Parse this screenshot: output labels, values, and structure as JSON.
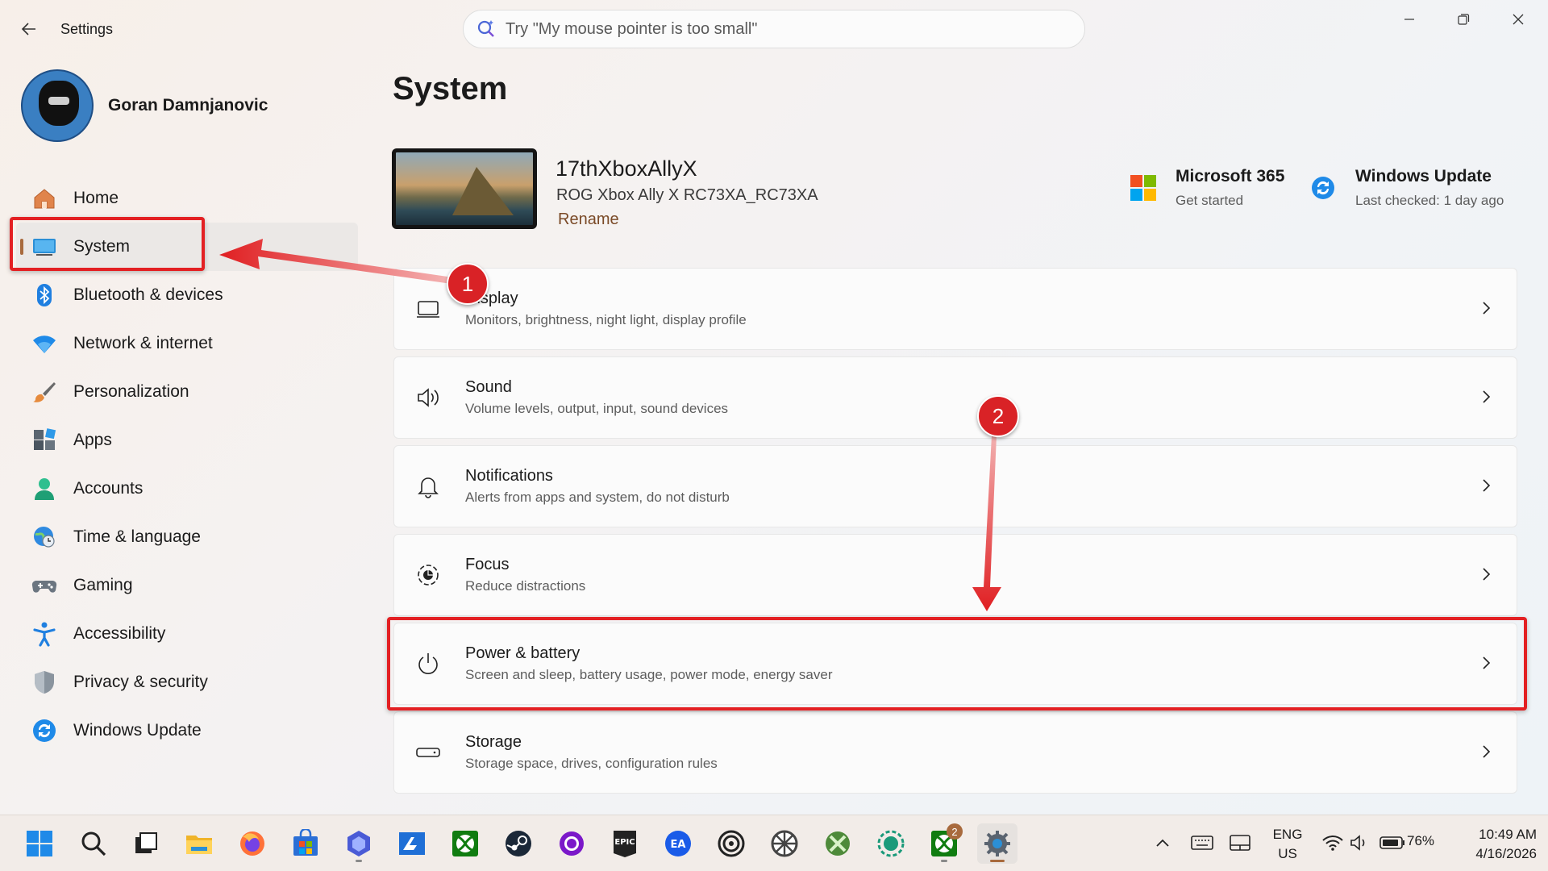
{
  "app": {
    "title": "Settings"
  },
  "search": {
    "placeholder": "Try \"My mouse pointer is too small\""
  },
  "profile": {
    "name": "Goran Damnjanovic"
  },
  "sidebar": {
    "items": [
      {
        "label": "Home",
        "icon": "home-icon",
        "active": false
      },
      {
        "label": "System",
        "icon": "system-icon",
        "active": true
      },
      {
        "label": "Bluetooth & devices",
        "icon": "bluetooth-icon",
        "active": false
      },
      {
        "label": "Network & internet",
        "icon": "wifi-icon",
        "active": false
      },
      {
        "label": "Personalization",
        "icon": "brush-icon",
        "active": false
      },
      {
        "label": "Apps",
        "icon": "apps-icon",
        "active": false
      },
      {
        "label": "Accounts",
        "icon": "accounts-icon",
        "active": false
      },
      {
        "label": "Time & language",
        "icon": "globe-clock-icon",
        "active": false
      },
      {
        "label": "Gaming",
        "icon": "gamepad-icon",
        "active": false
      },
      {
        "label": "Accessibility",
        "icon": "accessibility-icon",
        "active": false
      },
      {
        "label": "Privacy & security",
        "icon": "shield-icon",
        "active": false
      },
      {
        "label": "Windows Update",
        "icon": "update-icon",
        "active": false
      }
    ]
  },
  "main": {
    "page_title": "System",
    "device": {
      "name": "17thXboxAllyX",
      "model": "ROG Xbox Ally X RC73XA_RC73XA",
      "rename_label": "Rename"
    },
    "quick_links": {
      "ms365": {
        "title": "Microsoft 365",
        "subtitle": "Get started"
      },
      "windows_update": {
        "title": "Windows Update",
        "subtitle": "Last checked: 1 day ago"
      }
    },
    "cards": [
      {
        "title": "Display",
        "desc": "Monitors, brightness, night light, display profile",
        "icon": "monitor-icon"
      },
      {
        "title": "Sound",
        "desc": "Volume levels, output, input, sound devices",
        "icon": "speaker-icon"
      },
      {
        "title": "Notifications",
        "desc": "Alerts from apps and system, do not disturb",
        "icon": "bell-icon"
      },
      {
        "title": "Focus",
        "desc": "Reduce distractions",
        "icon": "focus-icon"
      },
      {
        "title": "Power & battery",
        "desc": "Screen and sleep, battery usage, power mode, energy saver",
        "icon": "power-icon"
      },
      {
        "title": "Storage",
        "desc": "Storage space, drives, configuration rules",
        "icon": "storage-icon"
      }
    ]
  },
  "annotations": {
    "step1": "1",
    "step2": "2",
    "color": "#e32023"
  },
  "taskbar": {
    "apps": [
      "start-icon",
      "search-icon",
      "task-view-icon",
      "file-explorer-icon",
      "firefox-icon",
      "store-icon",
      "vpn-icon",
      "mail-icon",
      "xbox-icon",
      "steam-icon",
      "circle-app-icon",
      "epic-games-icon",
      "ea-app-icon",
      "ubisoft-icon",
      "wheel-app-icon",
      "xbox-game-icon",
      "camera-app-icon",
      "xbox-app-icon",
      "settings-icon"
    ],
    "xbox_badge": "2",
    "language": {
      "line1": "ENG",
      "line2": "US"
    },
    "battery": "76%",
    "time": "10:49 AM",
    "date": "4/16/2026"
  },
  "colors": {
    "accent": "#a86a3d",
    "highlight": "#e32023",
    "badge": "#d92226"
  }
}
